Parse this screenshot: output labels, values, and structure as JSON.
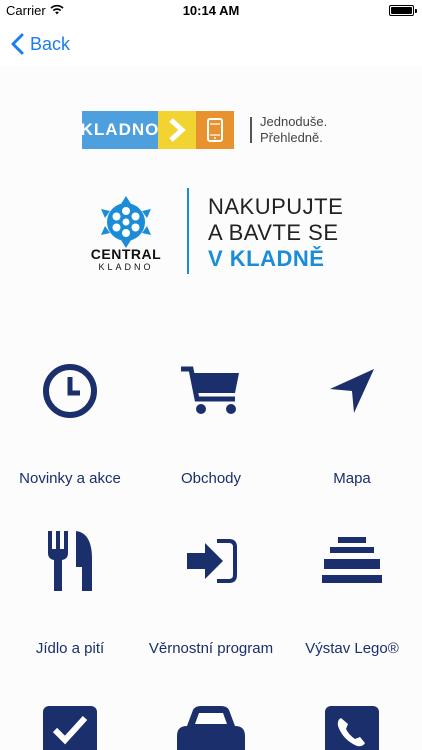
{
  "status_bar": {
    "carrier": "Carrier",
    "time": "10:14 AM"
  },
  "nav": {
    "back_label": "Back"
  },
  "kladno_banner": {
    "logo_text": "KLADNO",
    "slogan_line1": "Jednoduše.",
    "slogan_line2": "Přehledně."
  },
  "central_banner": {
    "name": "CENTRAL",
    "subname": "KLADNO",
    "slogan_line1": "NAKUPUJTE",
    "slogan_line2": "A BAVTE SE",
    "slogan_line3": "V KLADNĚ"
  },
  "menu": [
    {
      "label": "Novinky a akce",
      "icon": "clock-icon"
    },
    {
      "label": "Obchody",
      "icon": "shopping-cart-icon"
    },
    {
      "label": "Mapa",
      "icon": "navigation-arrow-icon"
    },
    {
      "label": "Jídlo a pití",
      "icon": "fork-knife-icon"
    },
    {
      "label": "Věrnostní program",
      "icon": "sign-in-icon"
    },
    {
      "label": "Výstav Lego®",
      "icon": "lego-stack-icon"
    },
    {
      "label": "",
      "icon": "checkbox-icon"
    },
    {
      "label": "",
      "icon": "car-icon"
    },
    {
      "label": "",
      "icon": "phone-icon"
    }
  ],
  "colors": {
    "accent_blue": "#1b7ef0",
    "icon_navy": "#1a2f6b",
    "kladno_blue": "#4d9fde",
    "kladno_yellow": "#f1d332",
    "kladno_orange": "#e8922f",
    "central_blue": "#1b8dd8"
  }
}
